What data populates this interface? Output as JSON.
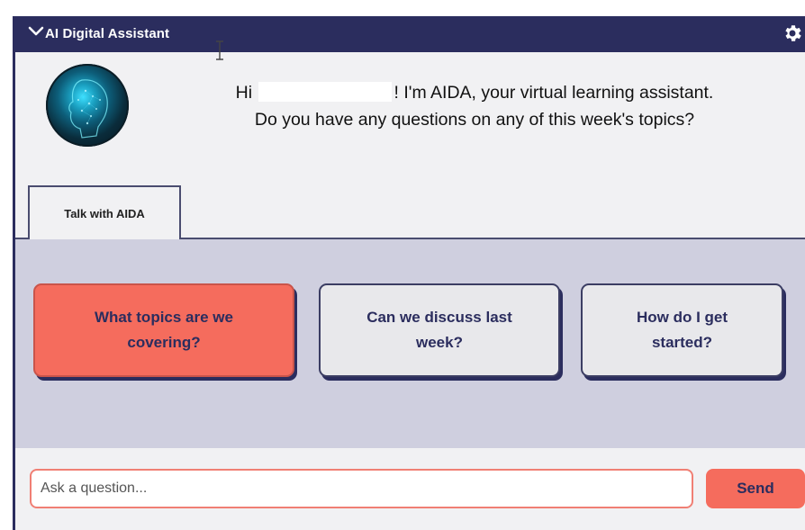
{
  "header": {
    "title": "AI Digital Assistant",
    "collapse_icon": "chevron-down-icon",
    "settings_icon": "gear-icon",
    "background_color": "#2b2d5e"
  },
  "greeting": {
    "hi": "Hi",
    "line1_rest": "! I'm AIDA, your virtual learning assistant.",
    "line2": "Do you have any questions on any of this week's topics?"
  },
  "tabs": [
    {
      "label": "Talk with AIDA",
      "active": true
    }
  ],
  "suggestions": [
    {
      "label": "What topics are we covering?",
      "active": true
    },
    {
      "label": "Can we discuss last week?",
      "active": false
    },
    {
      "label": "How do I get started?",
      "active": false
    }
  ],
  "input": {
    "placeholder": "Ask a question...",
    "value": ""
  },
  "send_label": "Send",
  "colors": {
    "accent": "#f56c5d",
    "navy": "#2b2d5e",
    "chip_area": "#cfcfdf"
  }
}
